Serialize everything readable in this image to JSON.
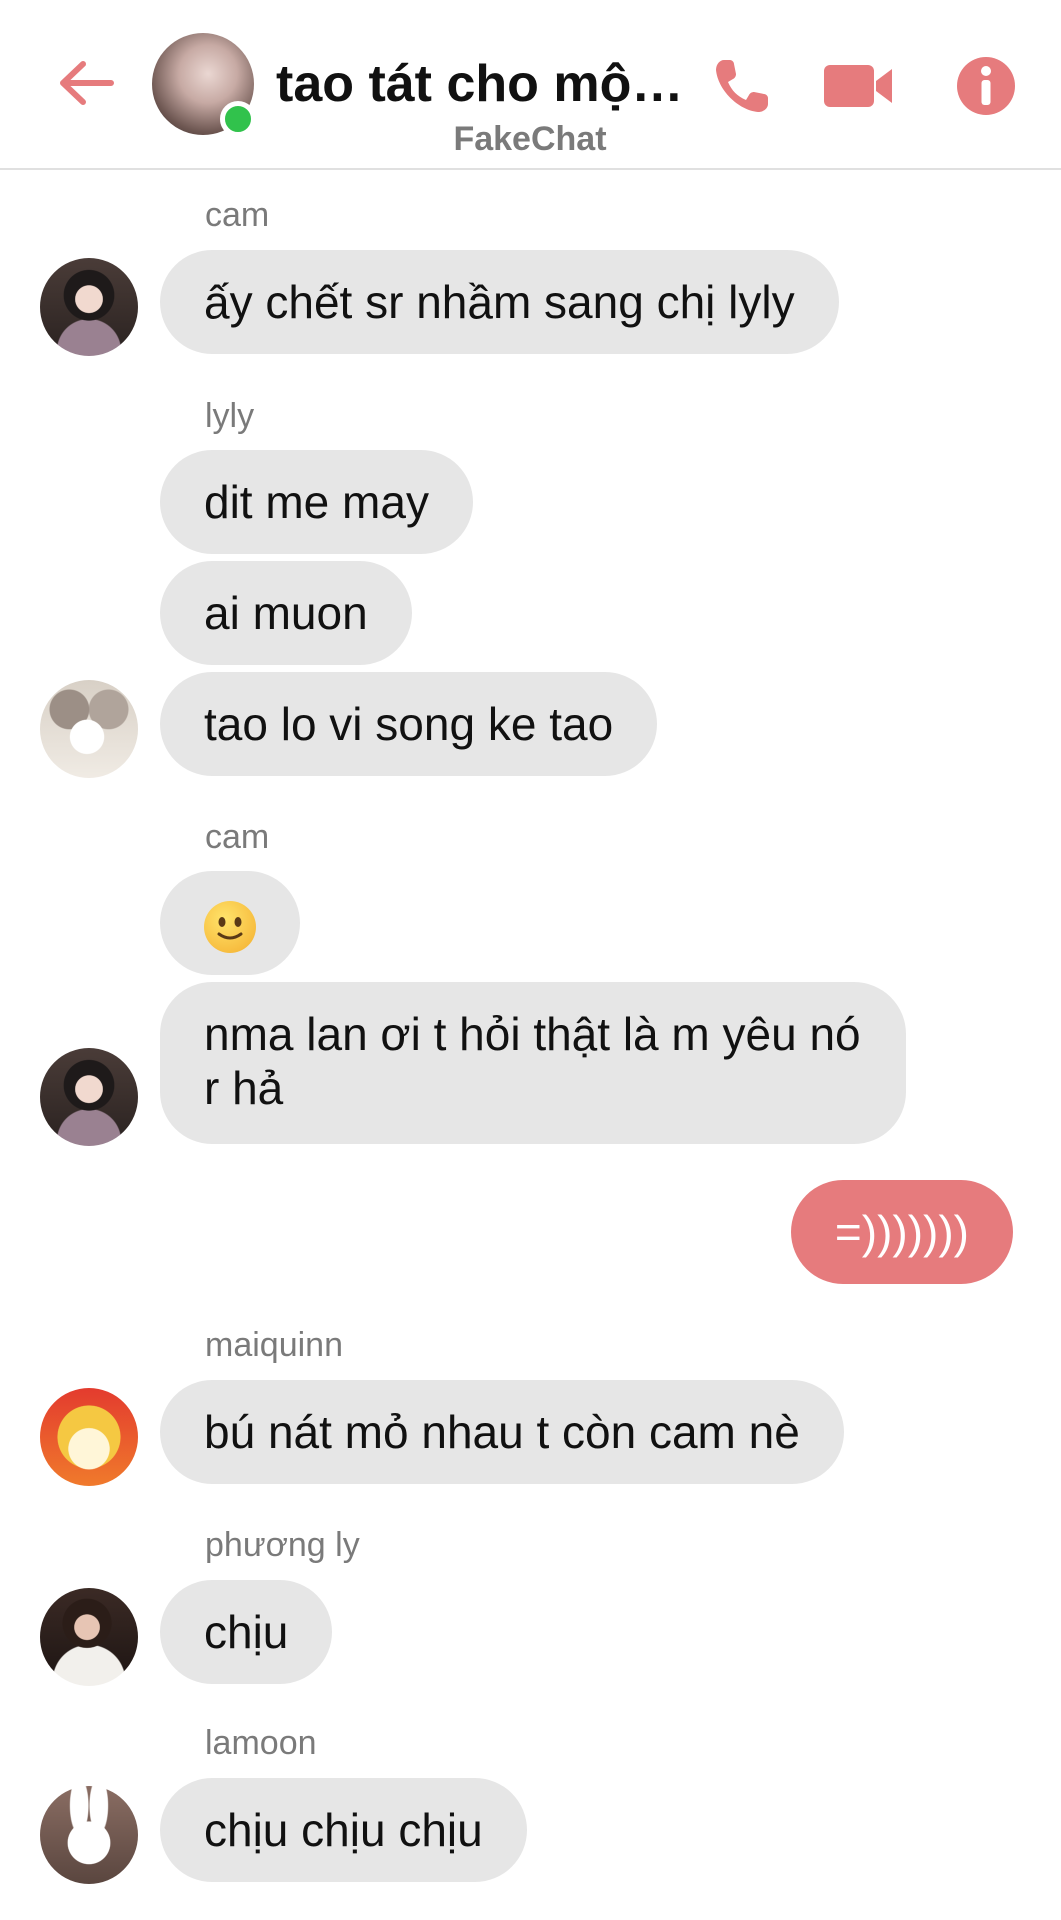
{
  "header": {
    "title": "tao tát cho một ...",
    "subtitle": "FakeChat",
    "icons": {
      "back": "back-arrow-icon",
      "phone": "phone-icon",
      "video": "video-camera-icon",
      "info": "info-icon"
    },
    "online": true
  },
  "colors": {
    "accent": "#e67b7d",
    "bubble_other": "#e6e6e6",
    "online": "#31c24c",
    "sender_name": "#7a7a7a"
  },
  "messages": [
    {
      "sender": "cam",
      "bubbles": [
        "ấy chết sr nhầm sang chị lyly"
      ]
    },
    {
      "sender": "lyly",
      "bubbles": [
        "dit me may",
        "ai muon",
        "tao lo vi song ke tao"
      ]
    },
    {
      "sender": "cam",
      "bubbles": [
        "slightly-smiling-face-emoji",
        "nma lan ơi t hỏi thật là m yêu nó r hả"
      ]
    },
    {
      "sender": "me",
      "bubbles": [
        "=)))))))"
      ]
    },
    {
      "sender": "maiquinn",
      "bubbles": [
        "bú nát mỏ nhau t còn cam nè"
      ]
    },
    {
      "sender": "phương ly",
      "bubbles": [
        "chịu"
      ]
    },
    {
      "sender": "lamoon",
      "bubbles": [
        "chịu chịu chịu"
      ]
    }
  ]
}
